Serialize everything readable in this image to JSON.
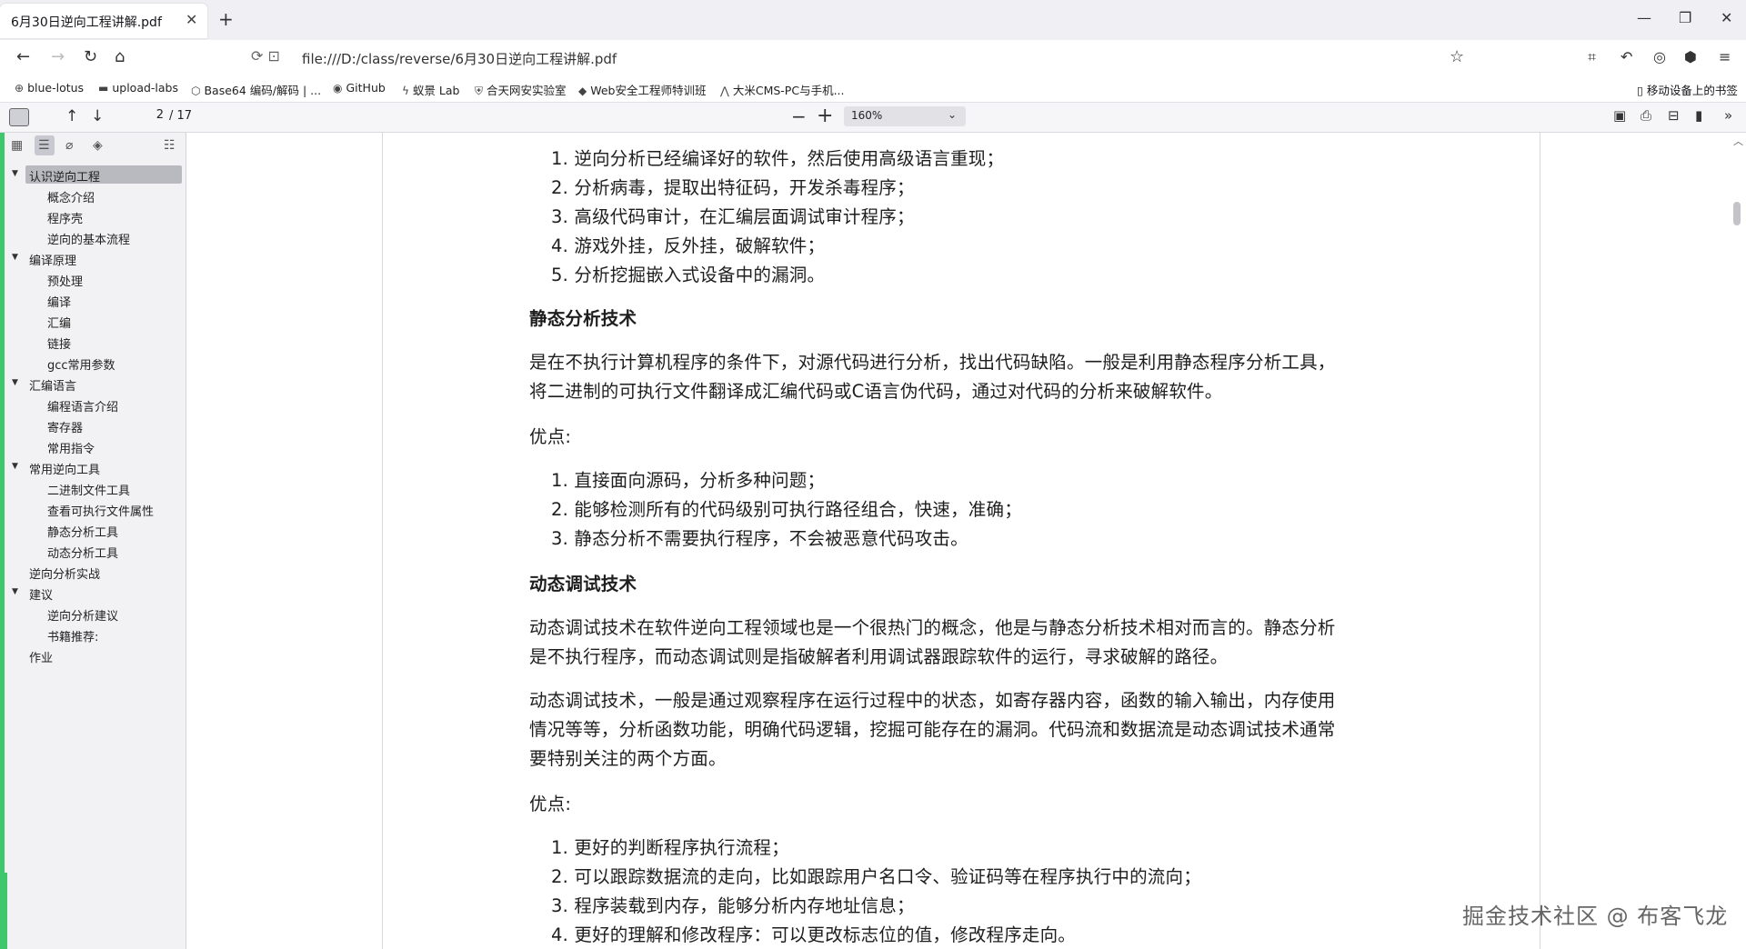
{
  "browser": {
    "tab_title": "6月30日逆向工程讲解.pdf",
    "tab_close_icon": "✕",
    "new_tab_icon": "+",
    "window_controls": [
      "—",
      "❐",
      "✕"
    ],
    "url": "file:///D:/class/reverse/6月30日逆向工程讲解.pdf",
    "bookmarks": [
      {
        "icon": "globe-icon",
        "glyph": "⊕",
        "label": "blue-lotus"
      },
      {
        "icon": "folder-icon",
        "glyph": "▬",
        "label": "upload-labs"
      },
      {
        "icon": "cube-icon",
        "glyph": "⬡",
        "label": "Base64 编码/解码 | ..."
      },
      {
        "icon": "github-icon",
        "glyph": "◉",
        "label": "GitHub"
      },
      {
        "icon": "bolt-icon",
        "glyph": "ϟ",
        "label": "蚁景 Lab"
      },
      {
        "icon": "shield-icon",
        "glyph": "⛨",
        "label": "合天网安实验室"
      },
      {
        "icon": "diamond-icon",
        "glyph": "◆",
        "label": "Web安全工程师特训班"
      },
      {
        "icon": "mountain-icon",
        "glyph": "⋀",
        "label": "大米CMS-PC与手机..."
      }
    ],
    "mobile_bookmarks": "移动设备上的书签"
  },
  "pdf_toolbar": {
    "page_current": "2",
    "page_total": "/ 17",
    "zoom": "160%"
  },
  "outline": [
    {
      "label": "认识逆向工程",
      "level": 0,
      "expanded": true,
      "selected": true
    },
    {
      "label": "概念介绍",
      "level": 1
    },
    {
      "label": "程序壳",
      "level": 1
    },
    {
      "label": "逆向的基本流程",
      "level": 1
    },
    {
      "label": "编译原理",
      "level": 0,
      "expanded": true
    },
    {
      "label": "预处理",
      "level": 1
    },
    {
      "label": "编译",
      "level": 1
    },
    {
      "label": "汇编",
      "level": 1
    },
    {
      "label": "链接",
      "level": 1
    },
    {
      "label": "gcc常用参数",
      "level": 1
    },
    {
      "label": "汇编语言",
      "level": 0,
      "expanded": true
    },
    {
      "label": "编程语言介绍",
      "level": 1
    },
    {
      "label": "寄存器",
      "level": 1
    },
    {
      "label": "常用指令",
      "level": 1
    },
    {
      "label": "常用逆向工具",
      "level": 0,
      "expanded": true
    },
    {
      "label": "二进制文件工具",
      "level": 1
    },
    {
      "label": "查看可执行文件属性",
      "level": 1
    },
    {
      "label": "静态分析工具",
      "level": 1
    },
    {
      "label": "动态分析工具",
      "level": 1
    },
    {
      "label": "逆向分析实战",
      "level": 0
    },
    {
      "label": "建议",
      "level": 0,
      "expanded": true
    },
    {
      "label": "逆向分析建议",
      "level": 1
    },
    {
      "label": "书籍推荐:",
      "level": 1
    },
    {
      "label": "作业",
      "level": 0
    }
  ],
  "document": {
    "list1": [
      "1. 逆向分析已经编译好的软件，然后使用高级语言重现；",
      "2. 分析病毒，提取出特征码，开发杀毒程序；",
      "3. 高级代码审计，在汇编层面调试审计程序；",
      "4. 游戏外挂，反外挂，破解软件；",
      "5. 分析挖掘嵌入式设备中的漏洞。"
    ],
    "static_heading": "静态分析技术",
    "static_para": [
      "是在不执行计算机程序的条件下，对源代码进行分析，找出代码缺陷。一般是利用静态程序分析工具，",
      "将二进制的可执行文件翻译成汇编代码或C语言伪代码，通过对代码的分析来破解软件。"
    ],
    "pros_label_1": "优点:",
    "list2": [
      "1. 直接面向源码，分析多种问题；",
      "2. 能够检测所有的代码级别可执行路径组合，快速，准确；",
      "3. 静态分析不需要执行程序，不会被恶意代码攻击。"
    ],
    "dynamic_heading": "动态调试技术",
    "dynamic_para1": [
      "动态调试技术在软件逆向工程领域也是一个很热门的概念，他是与静态分析技术相对而言的。静态分析",
      "是不执行程序，而动态调试则是指破解者利用调试器跟踪软件的运行，寻求破解的路径。"
    ],
    "dynamic_para2": [
      "动态调试技术，一般是通过观察程序在运行过程中的状态，如寄存器内容，函数的输入输出，内存使用",
      "情况等等，分析函数功能，明确代码逻辑，挖掘可能存在的漏洞。代码流和数据流是动态调试技术通常",
      "要特别关注的两个方面。"
    ],
    "pros_label_2": "优点:",
    "list3": [
      "1. 更好的判断程序执行流程；",
      "2. 可以跟踪数据流的走向，比如跟踪用户名口令、验证码等在程序执行中的流向；",
      "3. 程序装载到内存，能够分析内存地址信息；",
      "4. 更好的理解和修改程序：可以更改标志位的值，修改程序走向。"
    ]
  },
  "watermark": "掘金技术社区 @ 布客飞龙",
  "colors": {
    "accent_green": "#3ec76c",
    "selection": "#b9b9c0"
  }
}
